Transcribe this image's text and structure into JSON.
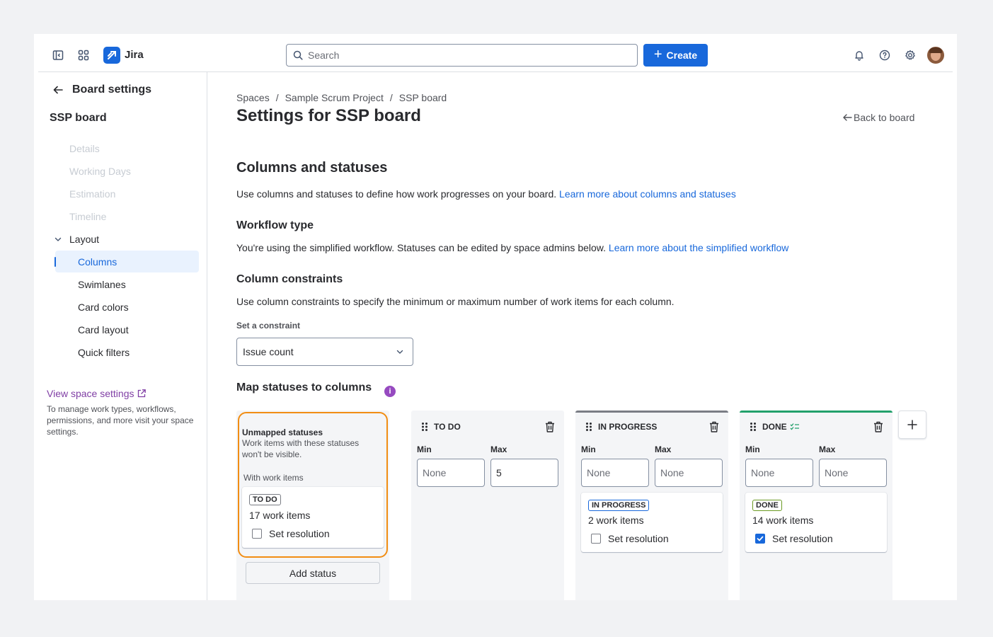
{
  "topnav": {
    "app_name": "Jira",
    "search_placeholder": "Search",
    "create_label": "Create",
    "accent": "#1868db"
  },
  "sidebar": {
    "back_title": "Board settings",
    "board_name": "SSP board",
    "disabled_items": [
      "Details",
      "Working Days",
      "Estimation",
      "Timeline"
    ],
    "layout_label": "Layout",
    "layout_items": [
      {
        "label": "Columns",
        "active": true
      },
      {
        "label": "Swimlanes"
      },
      {
        "label": "Card colors"
      },
      {
        "label": "Card layout"
      },
      {
        "label": "Quick filters"
      }
    ],
    "view_space_settings": "View space settings",
    "note": "To manage work types, workflows, permissions, and more visit your space settings."
  },
  "main": {
    "breadcrumb": [
      "Spaces",
      "Sample Scrum Project",
      "SSP board"
    ],
    "title": "Settings for SSP board",
    "back_to_board": "Back to board",
    "section_title": "Columns and statuses",
    "section_desc": "Use columns and statuses to define how work progresses on your board.",
    "section_link": "Learn more about columns and statuses",
    "workflow_title": "Workflow type",
    "workflow_desc": "You're using the simplified workflow. Statuses can be edited by space admins below.",
    "workflow_link": "Learn more about the simplified workflow",
    "constraints_title": "Column constraints",
    "constraints_desc": "Use column constraints to specify the minimum or maximum number of work items for each column.",
    "constraint_label": "Set a constraint",
    "constraint_value": "Issue count",
    "map_title": "Map statuses to columns"
  },
  "unmapped": {
    "title": "Unmapped statuses",
    "desc": "Work items with these statuses won't be visible.",
    "with_items": "With work items",
    "status": "TO DO",
    "count": "17 work items",
    "set_resolution": "Set resolution",
    "checked": false,
    "add_status": "Add status"
  },
  "columns": [
    {
      "name": "TO DO",
      "min_label": "Min",
      "max_label": "Max",
      "min": "",
      "max": "5",
      "placeholder": "None",
      "top_color": "",
      "status": null
    },
    {
      "name": "IN PROGRESS",
      "min_label": "Min",
      "max_label": "Max",
      "min": "",
      "max": "",
      "placeholder": "None",
      "top_color": "#7a7d85",
      "status": {
        "label": "IN PROGRESS",
        "count": "2 work items",
        "set_resolution": "Set resolution",
        "checked": false,
        "color": "#1868db"
      }
    },
    {
      "name": "DONE",
      "min_label": "Min",
      "max_label": "Max",
      "min": "",
      "max": "",
      "placeholder": "None",
      "top_color": "#22a06b",
      "status": {
        "label": "DONE",
        "count": "14 work items",
        "set_resolution": "Set resolution",
        "checked": true,
        "color": "#5b7f24"
      }
    }
  ]
}
